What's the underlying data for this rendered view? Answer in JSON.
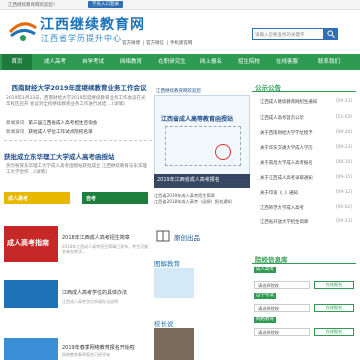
{
  "topbar": {
    "text": "江西继续教育网欢迎您！",
    "login_label": "学员入口登录"
  },
  "header": {
    "logo_title": "江西继续教育网",
    "logo_sub": "江西省学历提升中心",
    "links": [
      "官方微博",
      "官方微信",
      "手机版官网"
    ],
    "search_placeholder": "请输入您要查找的关键字"
  },
  "nav": {
    "items": [
      "首页",
      "成人高考",
      "自学考试",
      "网络教育",
      "在职研究生",
      "网上报名",
      "招生院校",
      "在线客服",
      "联系我们"
    ]
  },
  "left": {
    "headline": "西南财经大学2019年度继续教育业务工作会议",
    "headline_text": "2019年1月23日，西南财经大学2019年度继续教育业务工作会议在光华校区召开 会议对全校继续教育业务工作进行总结 ...[详情]",
    "news1_tag": "新闻资讯",
    "news1_text": "第三届江西省成人高考招生咨询会",
    "news2_tag": "新闻资讯",
    "news2_text": "获批成人学位工作试点院校名单",
    "story_title": "获批成立东华理工大学成人高考函授站",
    "story_text": "热烈祝贺东华理工大学成人高考函授站获批成立 江西继续教育与东华理工大学合作 ...[详情]",
    "banner1": "成人高考",
    "banner2": "自考",
    "items": [
      {
        "title": "2018年江西成人高考招生简章",
        "desc": "2018年江西成人高考招生简章已发布，考生可报名参加考试...",
        "thumb": "成人高考指南"
      },
      {
        "title": "江西成人高考学位的具体办法",
        "desc": "江西成人高考学位申请办法说明"
      },
      {
        "title": "2019年春季网络教育报名开始啦",
        "desc": "网络教育春季报名已经开始"
      }
    ]
  },
  "mid": {
    "card_head": "江西继续教育网欢迎您",
    "cert_title": "江西省成人高等教育函授站",
    "caption": "2019年江西省成人高考报名",
    "list": [
      "江西省2019年成人高考招生简章",
      "江西省2018年成人高考（函授）报名通知"
    ],
    "card2_title": "原创出品",
    "card3_title": "图解教育",
    "card4_title": "校长说"
  },
  "right": {
    "notice_title": "公示公告",
    "notices": [
      {
        "text": "江西成人继续教育网招生通知",
        "date": "[09-23]"
      },
      {
        "text": "江西成人高考首页公示",
        "date": "[12-03]"
      },
      {
        "text": "关于西南财经大学学位授予",
        "date": "[09-20]"
      },
      {
        "text": "关于华东交通大学成人学历",
        "date": "[09-23]"
      },
      {
        "text": "关于南昌大学成人高考报名",
        "date": "[08-10]"
      },
      {
        "text": "关于江西成人高考录取通知",
        "date": "[09-15]"
      },
      {
        "text": "关于印发《..》通知",
        "date": "[09-12]"
      },
      {
        "text": "江西师范大学成人高考",
        "date": "[06-02]"
      },
      {
        "text": "江西省开放大学招生简章",
        "date": "[09-23]"
      }
    ],
    "query_title": "院校信息库",
    "query_groups": [
      {
        "label": "成人高考",
        "select": "请选择院校",
        "button": "在线报名"
      },
      {
        "label": "自学考试",
        "select": "请选择院校",
        "button": "在线报名"
      },
      {
        "label": "网络教育",
        "select": "请选择院校",
        "button": "在线报名"
      }
    ]
  }
}
